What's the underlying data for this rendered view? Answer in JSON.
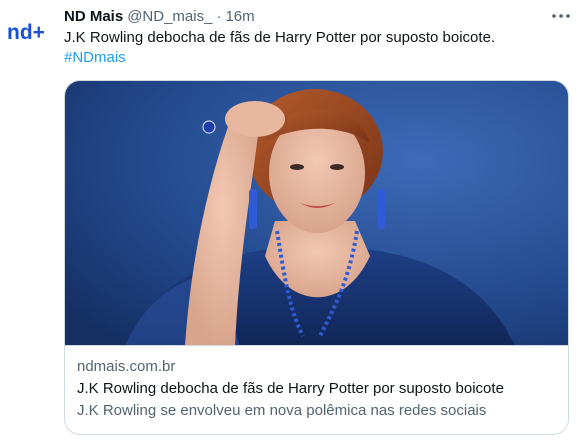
{
  "tweet": {
    "author_name": "ND Mais",
    "author_handle": "@ND_mais_",
    "separator": "·",
    "timestamp": "16m",
    "text": "J.K Rowling debocha de fãs de Harry Potter por suposto boicote.",
    "hashtag": "#NDmais",
    "avatar_logo": "nd+",
    "more_icon": "more-horizontal-icon"
  },
  "card": {
    "domain": "ndmais.com.br",
    "title": "J.K Rowling debocha de fãs de Harry Potter por suposto boicote",
    "description": "J.K Rowling se envolveu em nova polêmica nas redes sociais",
    "image_subject": "photo of a woman with auburn hair in a dark blue dress and blue earrings"
  },
  "colors": {
    "text_primary": "#0f1419",
    "text_secondary": "#536471",
    "link": "#1d9bf0",
    "border": "#cfd9de",
    "brand_blue": "#1a4fd8",
    "brand_pink": "#ff2d87"
  }
}
